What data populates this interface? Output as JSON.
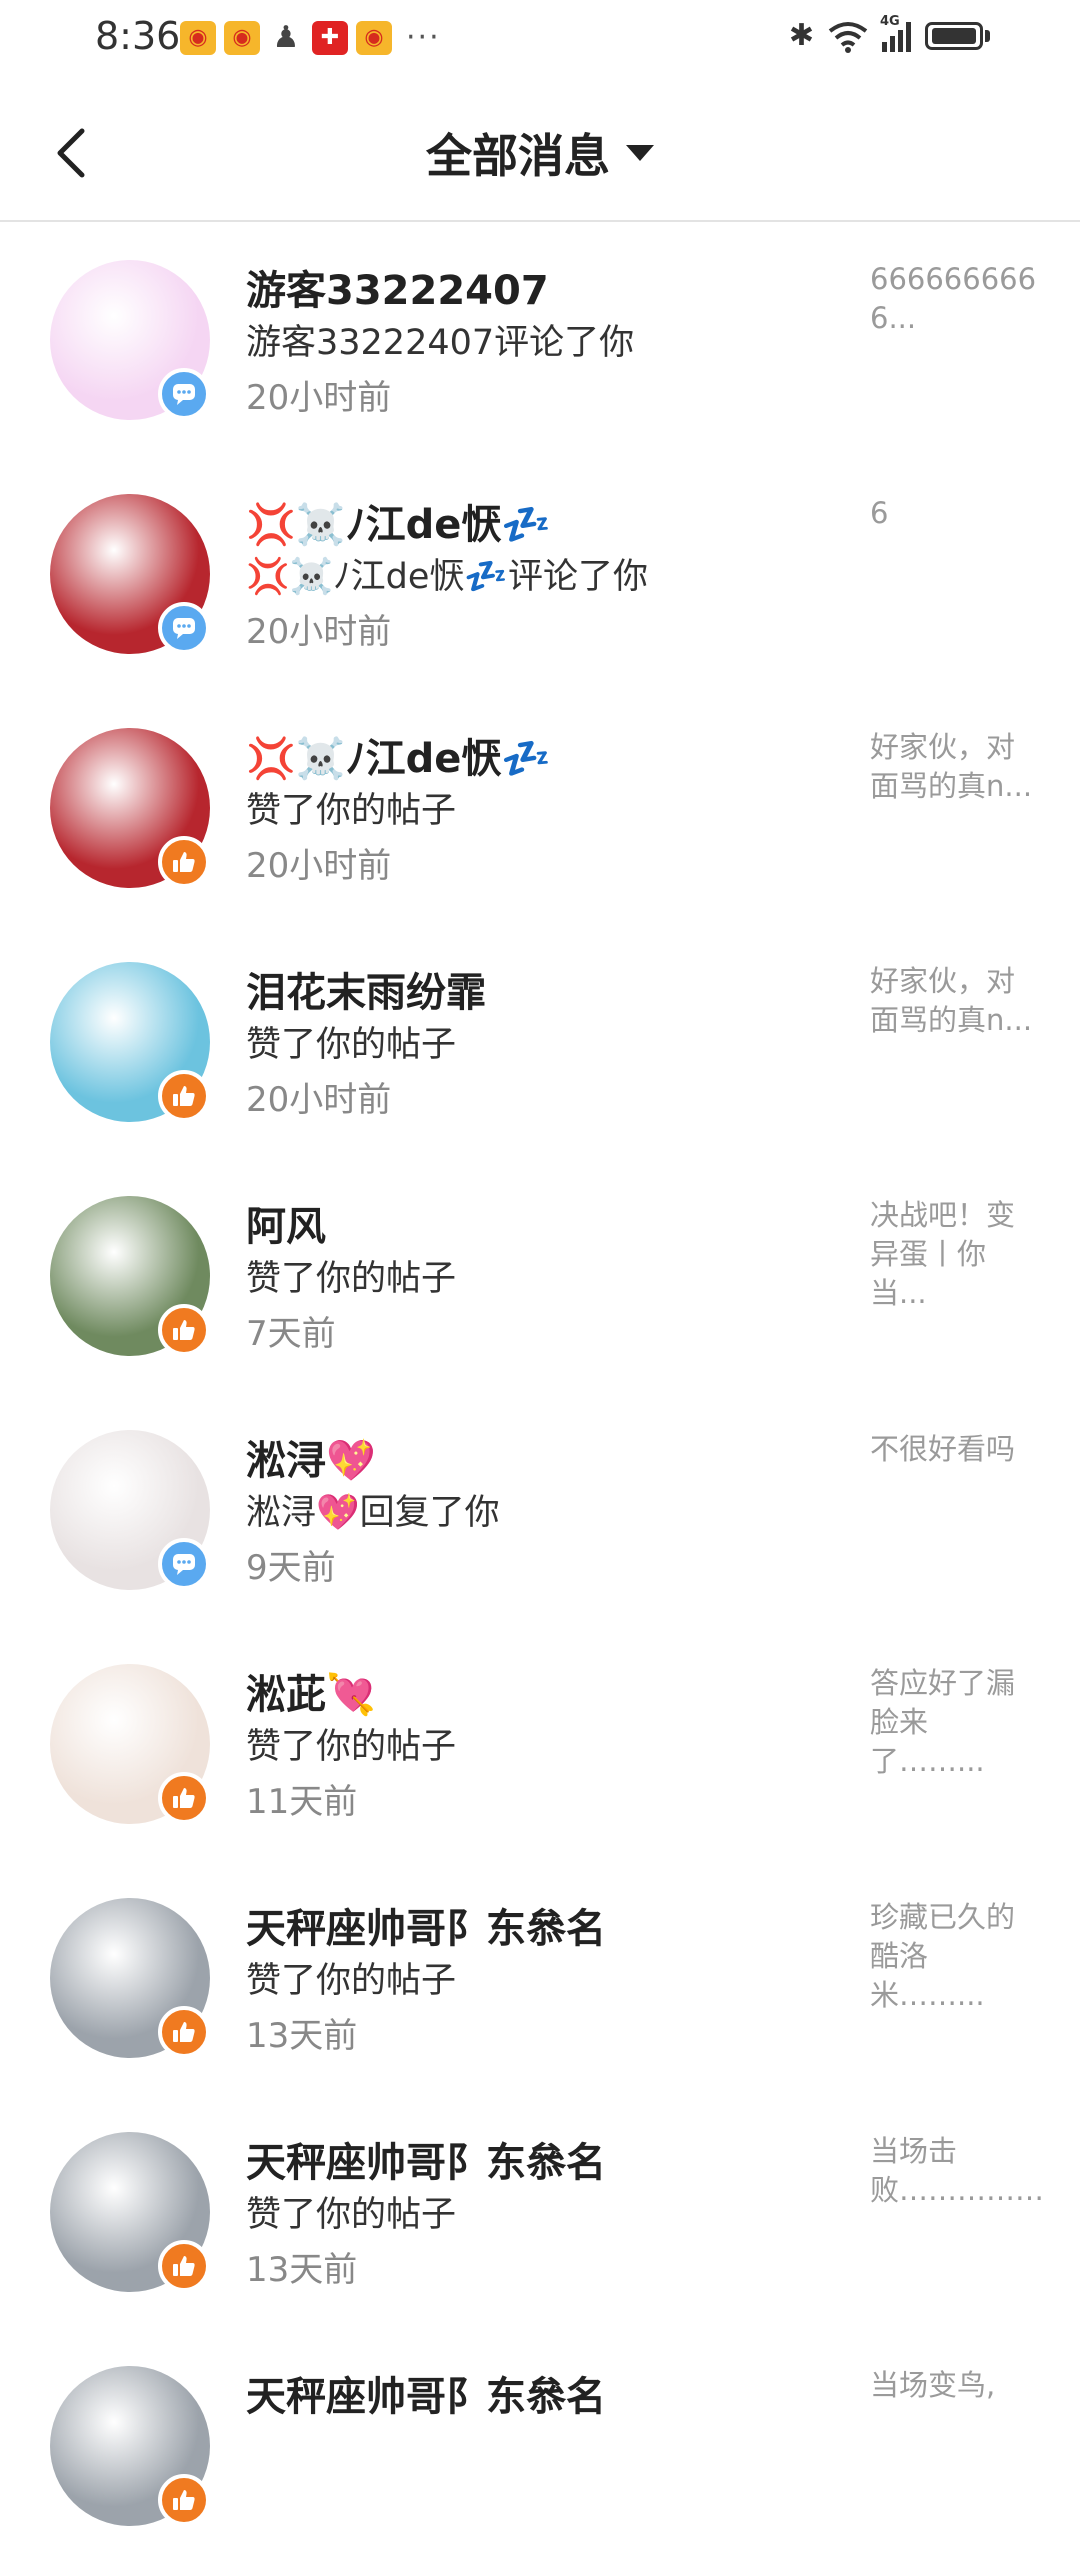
{
  "status_bar": {
    "time": "8:36",
    "more": "···",
    "network": "4G"
  },
  "header": {
    "title": "全部消息"
  },
  "messages": [
    {
      "name": "游客33222407",
      "action": "游客33222407评论了你",
      "time": "20小时前",
      "preview": "6666666666...",
      "type": "comment",
      "avatar_color": "#f5d6f3"
    },
    {
      "name": "💢☠️ﾉ江de恹💤",
      "action": "💢☠️ﾉ江de恹💤评论了你",
      "time": "20小时前",
      "preview": "6",
      "type": "comment",
      "avatar_color": "#b7262e"
    },
    {
      "name": "💢☠️ﾉ江de恹💤",
      "action": "赞了你的帖子",
      "time": "20小时前",
      "preview": "好家伙，对面骂的真n...",
      "type": "like",
      "avatar_color": "#b7262e"
    },
    {
      "name": "泪花末雨纷霏",
      "action": "赞了你的帖子",
      "time": "20小时前",
      "preview": "好家伙，对面骂的真n...",
      "type": "like",
      "avatar_color": "#6cc3df"
    },
    {
      "name": "阿风",
      "action": "赞了你的帖子",
      "time": "7天前",
      "preview": "决战吧！变异蛋丨你当...",
      "type": "like",
      "avatar_color": "#6f8a5f"
    },
    {
      "name": "淞浔💖",
      "action": "淞浔💖回复了你",
      "time": "9天前",
      "preview": "不很好看吗",
      "type": "comment",
      "avatar_color": "#e8e2e2"
    },
    {
      "name": "淞茈💘",
      "action": "赞了你的帖子",
      "time": "11天前",
      "preview": "答应好了漏脸来了……...",
      "type": "like",
      "avatar_color": "#efe2da"
    },
    {
      "name": "天秤座帅哥阝东叅名",
      "action": "赞了你的帖子",
      "time": "13天前",
      "preview": "珍藏已久的酷洛米……...",
      "type": "like",
      "avatar_color": "#9ca3ab"
    },
    {
      "name": "天秤座帅哥阝东叅名",
      "action": "赞了你的帖子",
      "time": "13天前",
      "preview": "当场击败……………",
      "type": "like",
      "avatar_color": "#9ca3ab"
    },
    {
      "name": "天秤座帅哥阝东叅名",
      "action": "",
      "time": "",
      "preview": "当场变鸟,",
      "type": "like",
      "avatar_color": "#9ca3ab"
    }
  ]
}
